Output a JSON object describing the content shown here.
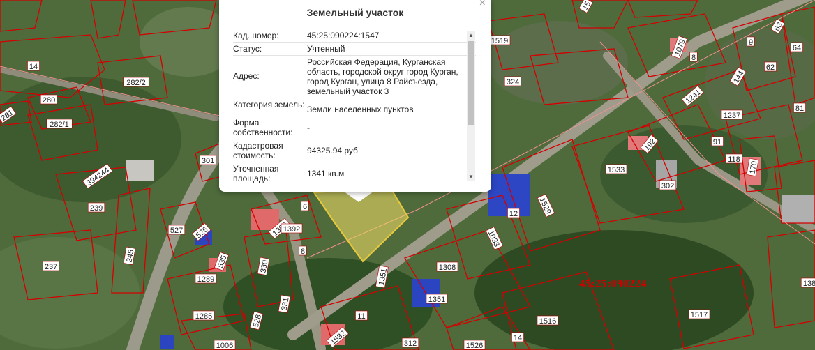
{
  "popup": {
    "title": "Земельный участок",
    "close": "×",
    "rows": [
      {
        "key": "Кад. номер:",
        "value": "45:25:090224:1547"
      },
      {
        "key": "Статус:",
        "value": "Учтенный"
      },
      {
        "key": "Адрес:",
        "value": "Российская Федерация, Курганская область, городской округ город Курган, город Курган, улица 8 Райсъезда, земельный участок 3"
      },
      {
        "key": "Категория земель:",
        "value": "Земли населенных пунктов"
      },
      {
        "key": "Форма собственности:",
        "value": "-"
      },
      {
        "key": "Кадастровая стоимость:",
        "value": "94325.94 руб"
      },
      {
        "key": "Уточненная площадь:",
        "value": "1341 кв.м"
      }
    ]
  },
  "map": {
    "quarter_code": "45:25:090224",
    "parcel_labels": [
      "14",
      "282/2",
      "280",
      "281",
      "282/1",
      "301",
      "394244",
      "239",
      "527",
      "526",
      "245",
      "237",
      "535",
      "1289",
      "330",
      "331",
      "1285",
      "528",
      "1006",
      "6",
      "1392",
      "1392",
      "8",
      "1351",
      "11",
      "1532",
      "312",
      "1308",
      "1351",
      "1526",
      "14",
      "1516",
      "1033",
      "12",
      "1529",
      "324",
      "1519",
      "15",
      "1079",
      "8",
      "9",
      "63",
      "64",
      "62",
      "144",
      "1241",
      "1237",
      "81",
      "192",
      "91",
      "118",
      "170",
      "1533",
      "302",
      "1517",
      "138"
    ],
    "colors": {
      "parcel_border": "#d40000",
      "selected_fill": "#f5e066",
      "selected_border": "#e8c93a"
    }
  }
}
